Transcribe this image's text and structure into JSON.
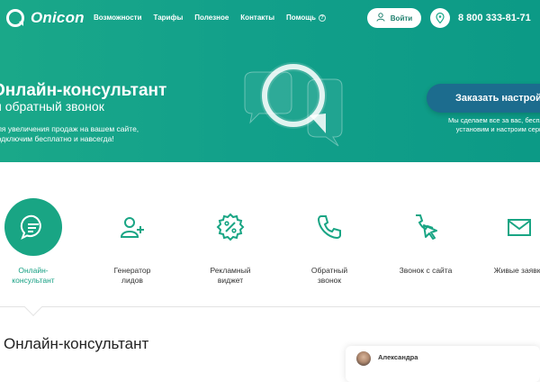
{
  "brand": {
    "name": "Onicon",
    "accent": "#19a584",
    "cta_color": "#1c6c8e"
  },
  "nav": {
    "items": [
      {
        "label": "Возможности"
      },
      {
        "label": "Тарифы"
      },
      {
        "label": "Полезное"
      },
      {
        "label": "Контакты"
      },
      {
        "label": "Помощь"
      }
    ],
    "help_icon": "?",
    "login_label": "Войти",
    "phone": "8 800 333-81-71"
  },
  "hero": {
    "title": "Онлайн-консультант",
    "subtitle": "и обратный звонок",
    "desc_line1": "для увеличения продаж на вашем сайте,",
    "desc_line2": "подключим бесплатно и навсегда!",
    "cta_label": "Заказать настройку",
    "cta_note_line1": "Мы сделаем все за вас, бесплатно",
    "cta_note_line2": "установим и настроим сервис"
  },
  "features": [
    {
      "label": "Онлайн-\nконсультант",
      "icon": "chat-bubble-icon",
      "active": true
    },
    {
      "label": "Генератор\nлидов",
      "icon": "user-plus-icon",
      "active": false
    },
    {
      "label": "Рекламный\nвиджет",
      "icon": "percent-badge-icon",
      "active": false
    },
    {
      "label": "Обратный\nзвонок",
      "icon": "phone-icon",
      "active": false
    },
    {
      "label": "Звонок с сайта",
      "icon": "phone-cursor-icon",
      "active": false
    },
    {
      "label": "Живые заявки",
      "icon": "envelope-icon",
      "active": false
    }
  ],
  "section": {
    "title": "Онлайн-консультант"
  },
  "chat_preview": {
    "operator_name": "Александра"
  }
}
